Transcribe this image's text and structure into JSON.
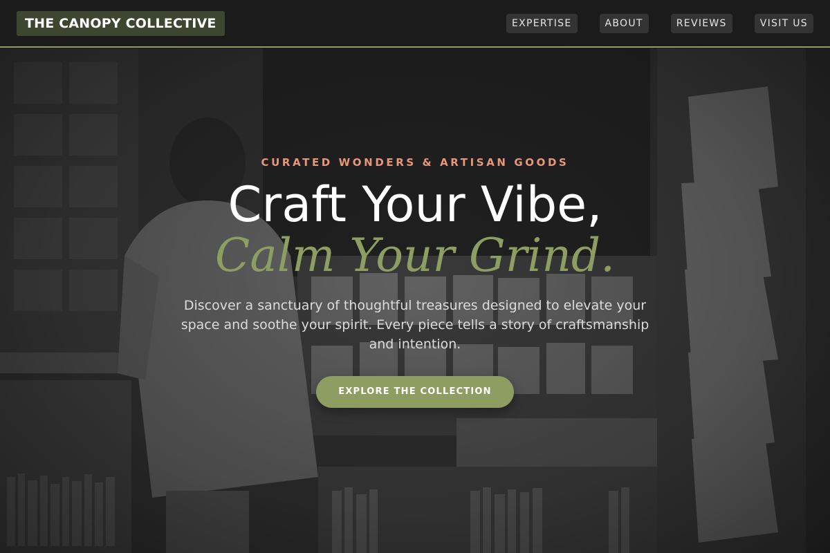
{
  "header": {
    "brand": "THE CANOPY COLLECTIVE",
    "nav": [
      {
        "label": "EXPERTISE"
      },
      {
        "label": "ABOUT"
      },
      {
        "label": "REVIEWS"
      },
      {
        "label": "VISIT US"
      }
    ]
  },
  "hero": {
    "eyebrow": "CURATED WONDERS & ARTISAN GOODS",
    "headline": "Craft Your Vibe,",
    "headline_accent": "Calm Your Grind.",
    "lede": "Discover a sanctuary of thoughtful treasures designed to elevate your space and soothe your spirit. Every piece tells a story of craftsmanship and intention.",
    "cta_label": "EXPLORE THE COLLECTION",
    "background_image": "grayscale photo of a shopper browsing a shop with bookshelves and greeting card racks"
  },
  "colors": {
    "accent_green": "#8e9e63",
    "brand_bg": "#3d4630",
    "eyebrow_coral": "#e8977a",
    "header_bg": "#1b1b1b"
  }
}
